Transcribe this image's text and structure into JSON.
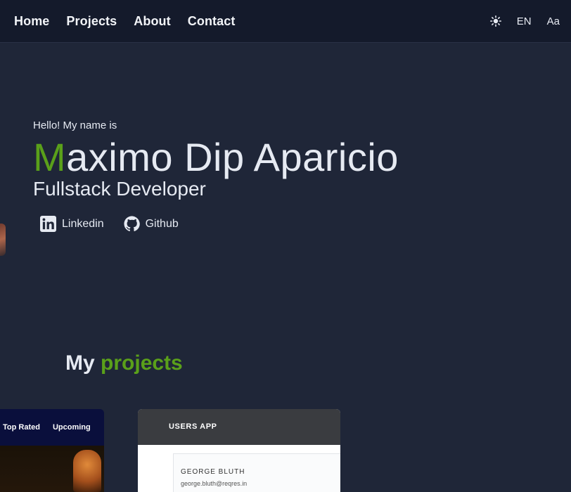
{
  "nav": {
    "links": [
      "Home",
      "Projects",
      "About",
      "Contact"
    ],
    "tools": {
      "theme_icon": "sun-icon",
      "language": "EN",
      "font_size": "Aa"
    }
  },
  "hero": {
    "greeting": "Hello! My name is",
    "name_initial": "M",
    "name_rest": "aximo Dip Aparicio",
    "role": "Fullstack Developer",
    "socials": [
      {
        "label": "Linkedin",
        "icon": "linkedin-icon"
      },
      {
        "label": "Github",
        "icon": "github-icon"
      }
    ]
  },
  "projects": {
    "heading_plain": "My",
    "heading_accent": "projects",
    "movie_app": {
      "nav": [
        "Top Rated",
        "Upcoming"
      ]
    },
    "users_app": {
      "title": "USERS APP",
      "user_name": "GEORGE BLUTH",
      "user_email": "george.bluth@reqres.in"
    }
  },
  "colors": {
    "background": "#1f2638",
    "navbar": "#141a2b",
    "accent": "#5aa01a",
    "text": "#e6eaf2"
  }
}
